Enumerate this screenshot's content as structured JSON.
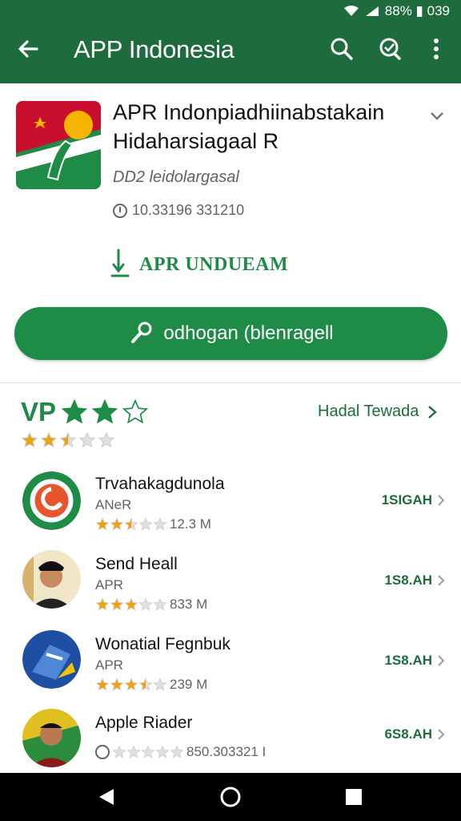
{
  "status_bar": {
    "text": "88% ▮ 039"
  },
  "app_bar": {
    "title": "APP Indonesia",
    "back_icon": "arrow-left-icon",
    "search_icon": "search-icon",
    "search2_icon": "search-icon",
    "more_icon": "more-vert-icon"
  },
  "app": {
    "name": "APR Indonpiadhiinabstakain Hidaharsiagaal R",
    "developer": "DD2 leidolargasal",
    "downloads": "10.33196 331210",
    "unduh_label": "APR UNDUEAM",
    "install_label": "odhogan (blenragell"
  },
  "related": {
    "title": "VP",
    "title_stars": 3,
    "rating": 2.5,
    "more_label": "Hadal Tewada",
    "items": [
      {
        "name": "Trvahakagdunola",
        "sub": "ANeR",
        "rating": 2.5,
        "size_text": "12.3 M",
        "action": "1SIGAH"
      },
      {
        "name": "Send Heall",
        "sub": "APR",
        "rating": 3,
        "size_text": "833 M",
        "action": "1S8.AH"
      },
      {
        "name": "Wonatial Fegnbuk",
        "sub": "APR",
        "rating": 3.5,
        "size_text": "239 M",
        "action": "1S8.AH"
      },
      {
        "name": "Apple Riader",
        "sub": "",
        "rating": 0,
        "size_text": "850.303321 I",
        "action": "6S8.AH"
      }
    ]
  },
  "colors": {
    "appbar": "#1e6b3d",
    "accent": "#1e8c46",
    "star": "#f0a10c"
  }
}
